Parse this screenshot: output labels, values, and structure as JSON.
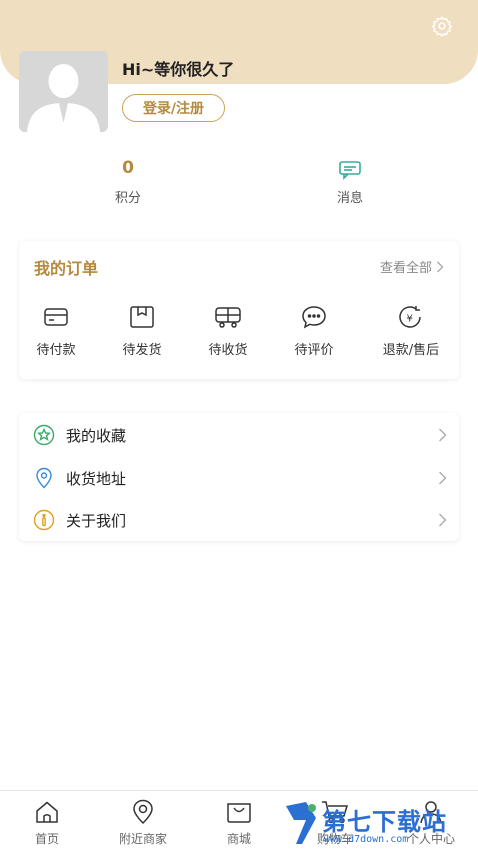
{
  "header": {
    "greeting": "Hi~等你很久了",
    "login_button": "登录/注册",
    "bg_color": "#efdfc0",
    "accent_color": "#b48a3e"
  },
  "stats": [
    {
      "value": "0",
      "label": "积分"
    },
    {
      "icon": "message-icon",
      "label": "消息"
    }
  ],
  "orders": {
    "title": "我的订单",
    "view_all": "查看全部",
    "items": [
      {
        "icon": "card-icon",
        "label": "待付款"
      },
      {
        "icon": "package-icon",
        "label": "待发货"
      },
      {
        "icon": "truck-icon",
        "label": "待收货"
      },
      {
        "icon": "comment-icon",
        "label": "待评价"
      },
      {
        "icon": "refund-icon",
        "label": "退款/售后"
      }
    ]
  },
  "menu": [
    {
      "icon": "star-icon",
      "label": "我的收藏",
      "color": "#3aaa6b"
    },
    {
      "icon": "location-icon",
      "label": "收货地址",
      "color": "#3a8ad6"
    },
    {
      "icon": "info-icon",
      "label": "关于我们",
      "color": "#e0a020"
    }
  ],
  "tabbar": [
    {
      "icon": "home-icon",
      "label": "首页"
    },
    {
      "icon": "map-pin-icon",
      "label": "附近商家"
    },
    {
      "icon": "shopping-bag-icon",
      "label": "商城"
    },
    {
      "icon": "cart-icon",
      "label": "购物车"
    },
    {
      "icon": "person-icon",
      "label": "个人中心"
    }
  ],
  "watermark": {
    "title": "第七下载站",
    "url": "www.d7down.com"
  }
}
